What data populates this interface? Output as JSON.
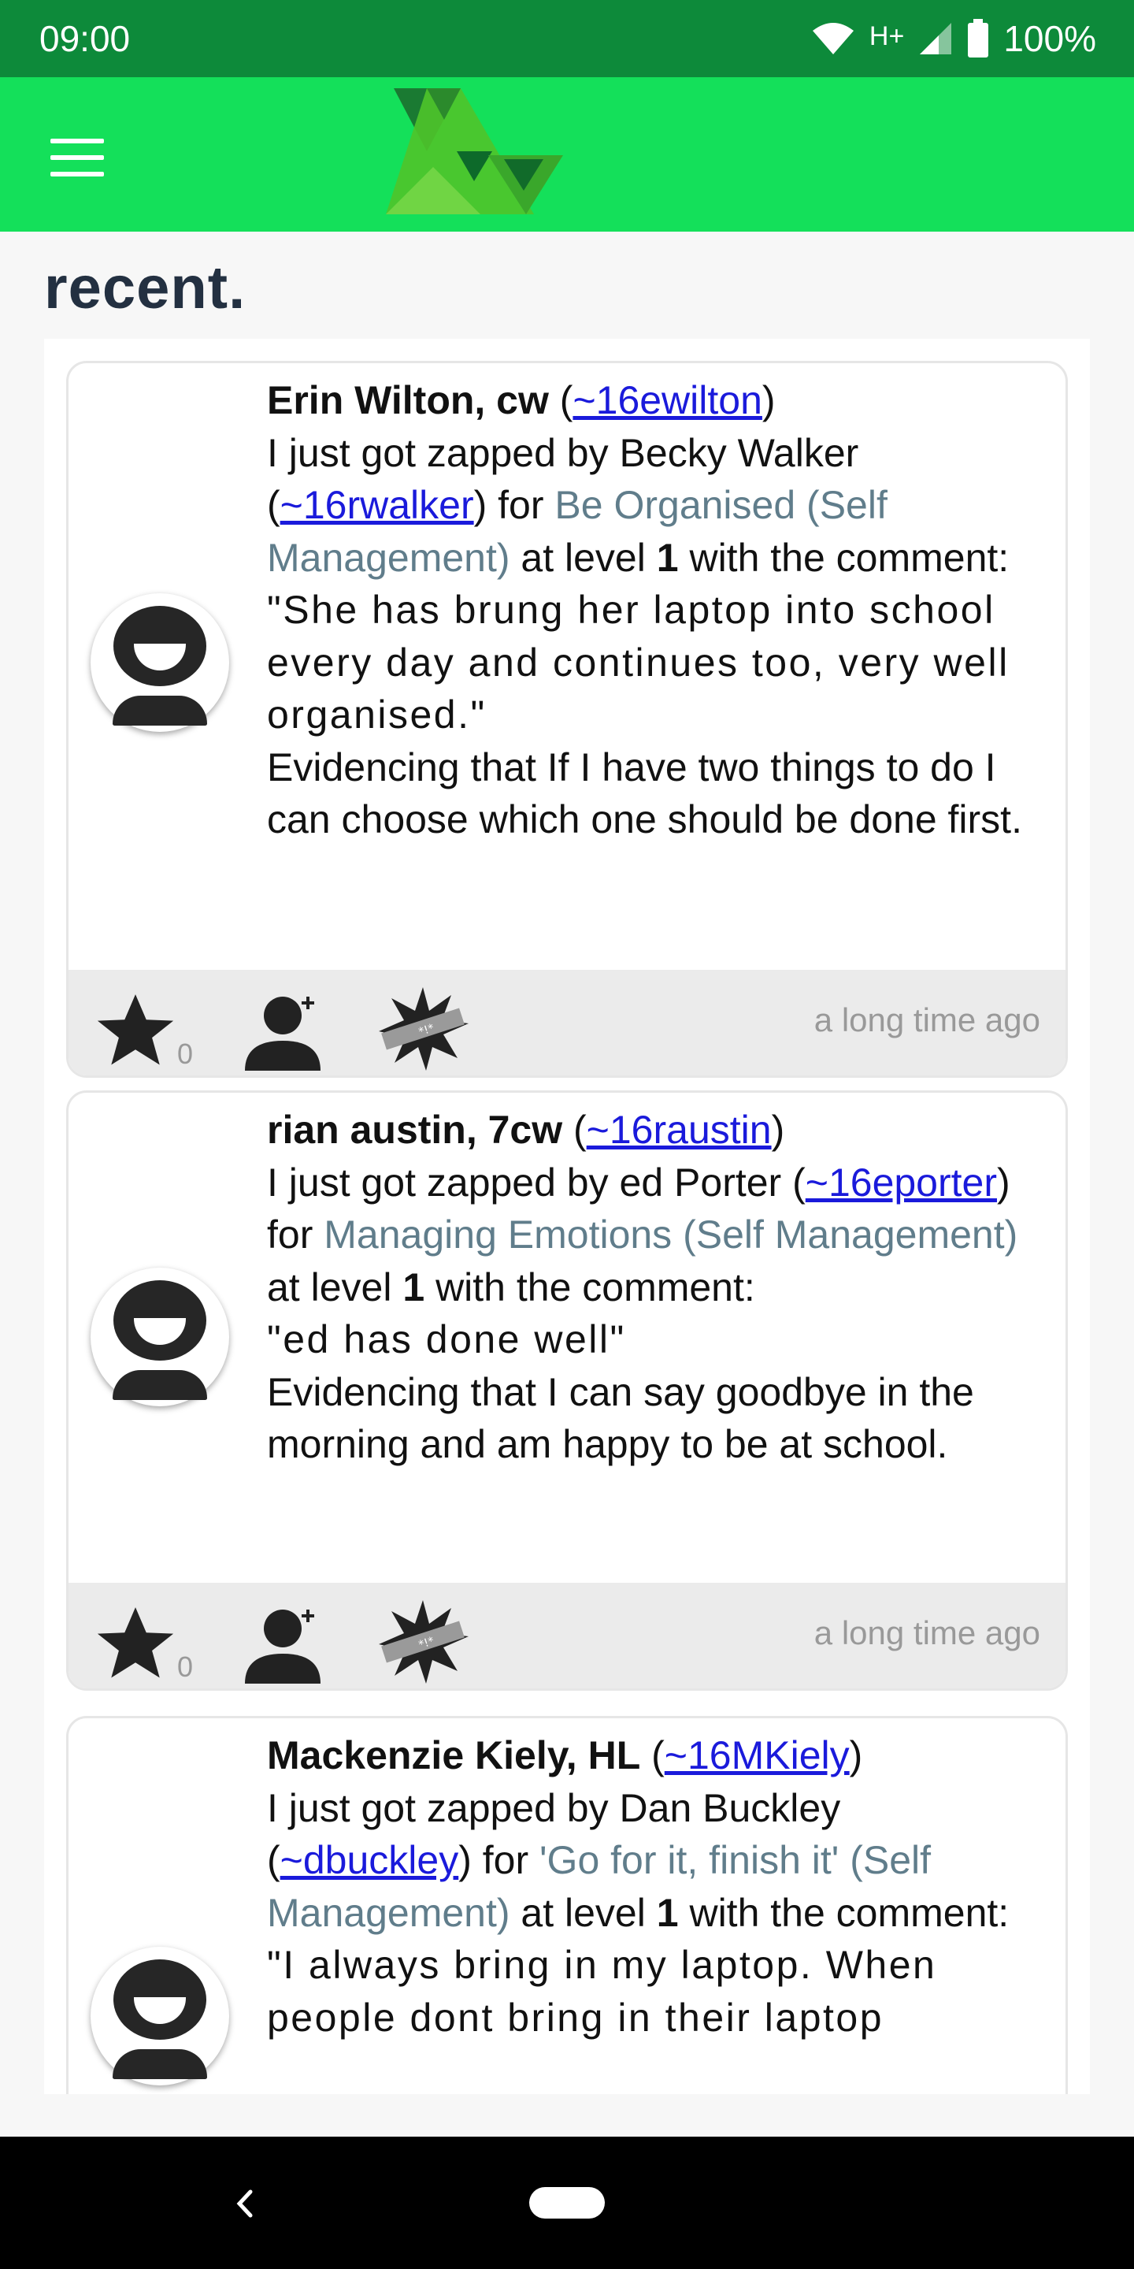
{
  "status_bar": {
    "time": "09:00",
    "network": "H+",
    "battery": "100%"
  },
  "app_bar": {
    "menu_icon": "hamburger-menu-icon",
    "logo_icon": "green-triangles-logo"
  },
  "section_title": "recent.",
  "colors": {
    "status_bar": "#0d8a3a",
    "app_bar": "#14e05a",
    "title": "#233041",
    "link": "#1a1adb",
    "skill": "#607d8b",
    "footer": "#ebebeb"
  },
  "cards": [
    {
      "name": "Erin Wilton, cw",
      "username": "~16ewilton",
      "zapped_by": "Becky Walker",
      "zapper_username": "~16rwalker",
      "skill": "Be Organised (Self Management)",
      "level": "1",
      "comment": "\"She has brung her laptop into school every day and continues too, very well organised.\"",
      "evidence": "Evidencing that If I have two things to do I can choose which one should be done first.",
      "star_count": "0",
      "timestamp": "a long time ago"
    },
    {
      "name": "rian austin, 7cw",
      "username": "~16raustin",
      "zapped_by": "ed Porter",
      "zapper_username": "~16eporter",
      "skill": "Managing Emotions (Self Management)",
      "level": "1",
      "comment": "\"ed has done well\"",
      "evidence": "Evidencing that I can say goodbye in the morning and am happy to be at school.",
      "star_count": "0",
      "timestamp": "a long time ago"
    },
    {
      "name": "Mackenzie Kiely, HL",
      "username": "~16MKiely",
      "zapped_by": "Dan Buckley",
      "zapper_username": "~dbuckley",
      "skill": "'Go for it, finish it' (Self Management)",
      "level": "1",
      "comment": "\"I always bring in my laptop. When people dont bring in their laptop"
    }
  ],
  "fixed_text": {
    "zapped_prefix": "I just got zapped by",
    "for": "for",
    "at_level": "at level",
    "with_comment": "with the comment:"
  }
}
